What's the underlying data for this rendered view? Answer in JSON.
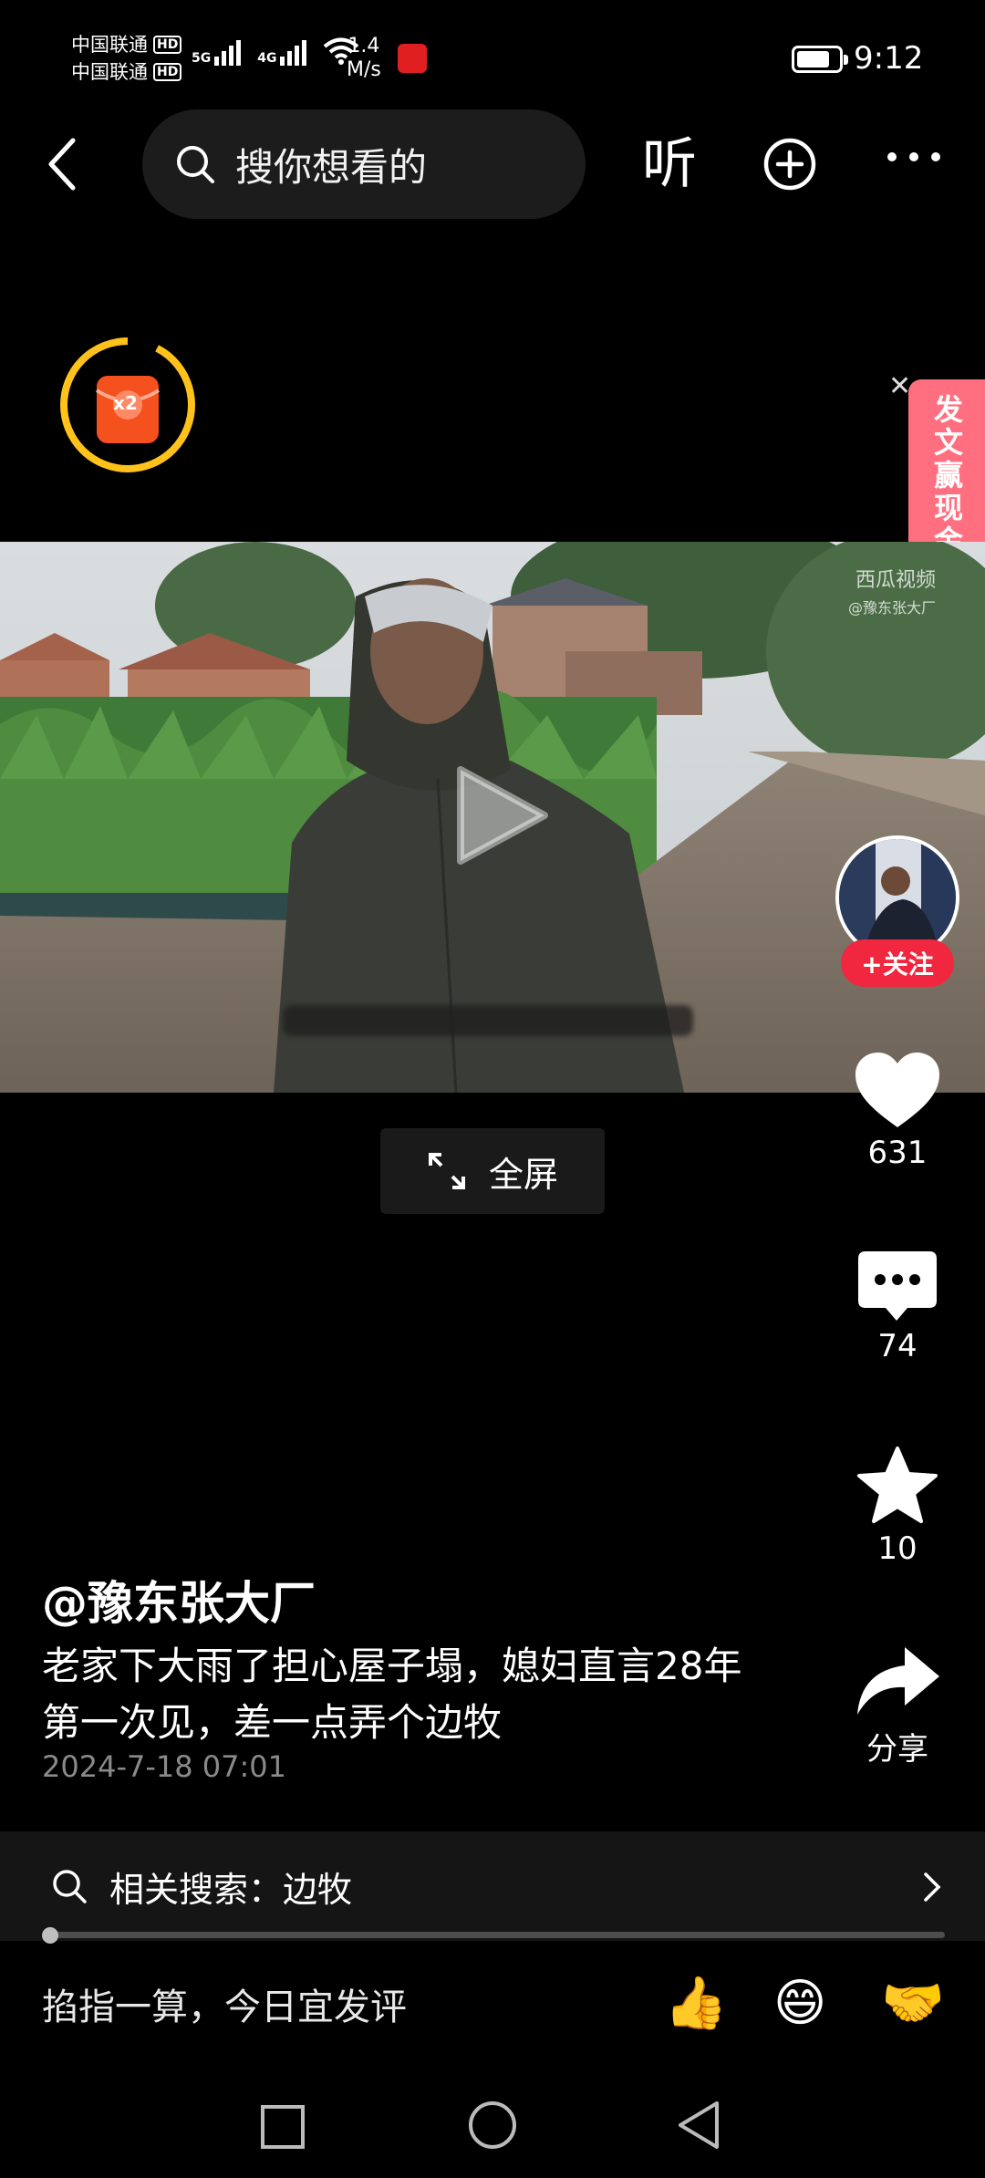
{
  "status_bar": {
    "carrier_1": "中国联通",
    "carrier_2": "中国联通",
    "hd": "HD",
    "network_1": "5G",
    "network_2": "4G",
    "speed_value": "1.4",
    "speed_unit": "M/s",
    "battery_level": 0.8,
    "time": "9:12"
  },
  "top_nav": {
    "search_placeholder": "搜你想看的",
    "listen_label": "听"
  },
  "reward": {
    "multiplier": "x2"
  },
  "promo": {
    "text": "发文赢现金",
    "close": "✕"
  },
  "video": {
    "watermark_line1": "西瓜视频",
    "watermark_line2": "@豫东张大厂",
    "fullscreen_label": "全屏"
  },
  "rail": {
    "follow_label": "+关注",
    "likes": "631",
    "comments": "74",
    "favorites": "10",
    "share_label": "分享"
  },
  "post": {
    "author": "@豫东张大厂",
    "title": "老家下大雨了担心屋子塌，媳妇直言28年第一次见，差一点弄个边牧",
    "timestamp": "2024-7-18 07:01"
  },
  "related_search": {
    "label": "相关搜索：边牧"
  },
  "playback": {
    "progress": 0.01
  },
  "comment_bar": {
    "prompt": "掐指一算，今日宜发评",
    "emojis": [
      "👍",
      "😄",
      "🤝"
    ]
  },
  "colors": {
    "accent_red": "#f0273f",
    "promo_pink": "#ff6f7f",
    "reward_yellow": "#ffc21a"
  }
}
